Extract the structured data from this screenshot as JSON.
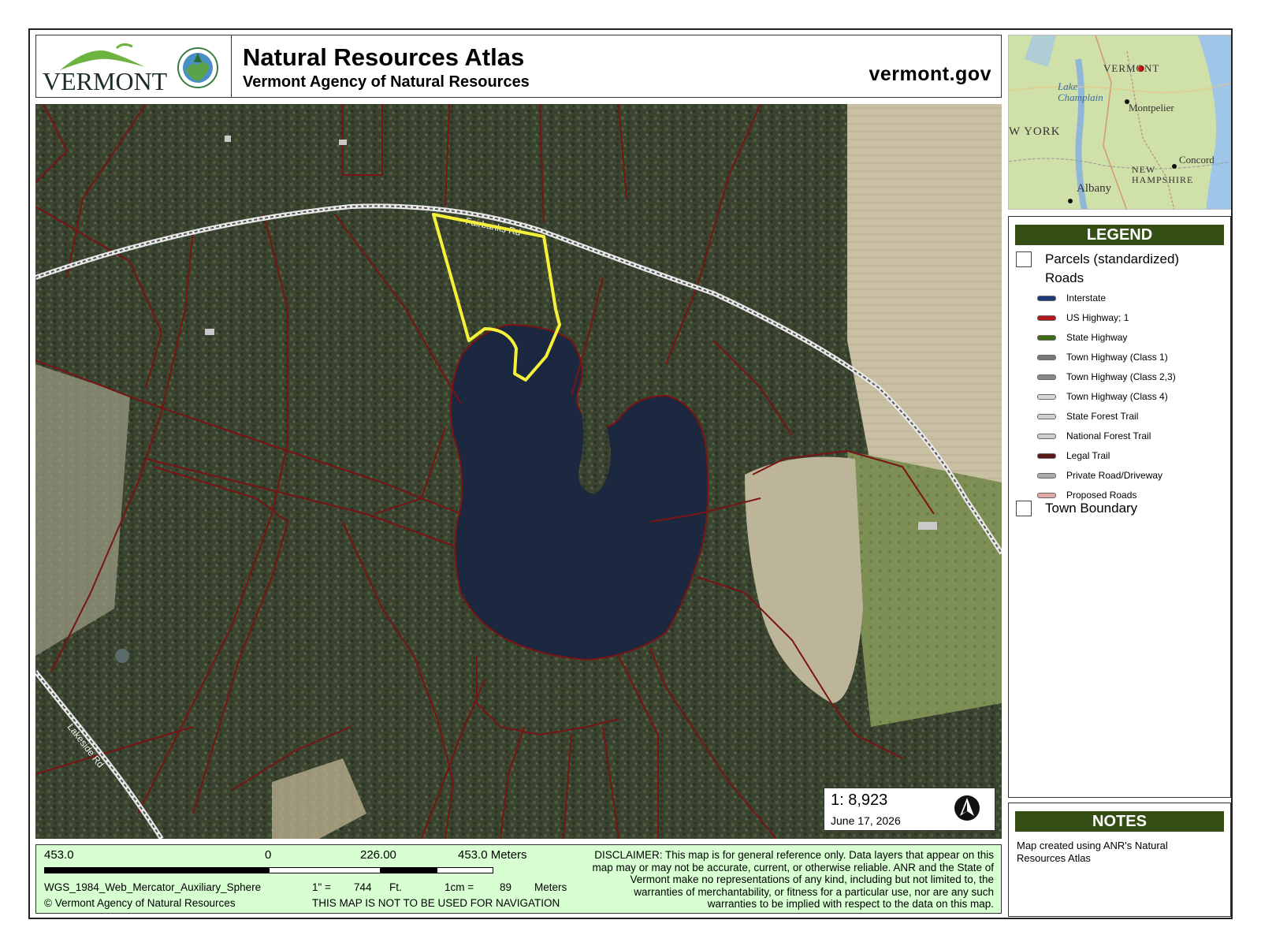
{
  "header": {
    "logo_text": "VERMONT",
    "title": "Natural Resources Atlas",
    "subtitle": "Vermont Agency of Natural Resources",
    "site": "vermont.gov"
  },
  "map": {
    "road_labels": [
      "Fairbanks Rd",
      "Lakeside Rd"
    ],
    "selected_parcel_color": "#f5f03a",
    "parcel_line_color": "#7a1414"
  },
  "scale_box": {
    "ratio": "1:  8,923",
    "date": "June 17, 2026",
    "north_arrow_icon": "north-arrow-icon"
  },
  "inset": {
    "labels": [
      "VERMONT",
      "Lake Champlain",
      "Montpelier",
      "W YORK",
      "Concord",
      "NEW HAMPSHIRE",
      "Albany"
    ]
  },
  "legend": {
    "heading": "LEGEND",
    "parcels_label": "Parcels (standardized)",
    "roads_label": "Roads",
    "road_items": [
      {
        "label": "Interstate",
        "color": "#1f3a78"
      },
      {
        "label": "US Highway; 1",
        "color": "#b3161b"
      },
      {
        "label": "State Highway",
        "color": "#3f6b14"
      },
      {
        "label": "Town Highway (Class 1)",
        "color": "#777777"
      },
      {
        "label": "Town Highway (Class 2,3)",
        "color": "#888888"
      },
      {
        "label": "Town Highway (Class 4)",
        "color": "#d7d7d7"
      },
      {
        "label": "State Forest Trail",
        "color": "#cfcfcf"
      },
      {
        "label": "National Forest Trail",
        "color": "#cfcfcf"
      },
      {
        "label": "Legal Trail",
        "color": "#5a1a1a"
      },
      {
        "label": "Private Road/Driveway",
        "color": "#aaaaaa"
      },
      {
        "label": "Proposed Roads",
        "color": "#e3a7a7"
      }
    ],
    "town_boundary_label": "Town Boundary"
  },
  "notes": {
    "heading": "NOTES",
    "text": "Map created using ANR's Natural Resources Atlas"
  },
  "footer": {
    "scale_labels": [
      "453.0",
      "0",
      "226.00",
      "453.0 Meters"
    ],
    "projection": "WGS_1984_Web_Mercator_Auxiliary_Sphere",
    "copyright": "© Vermont Agency of Natural Resources",
    "inch_label": "1\" =",
    "inch_value": "744",
    "inch_unit": "Ft.",
    "cm_label": "1cm =",
    "cm_value": "89",
    "cm_unit": "Meters",
    "navigation_warning": "THIS MAP IS NOT TO BE USED FOR NAVIGATION",
    "disclaimer": "DISCLAIMER: This map is for general reference only. Data layers that appear on this map may or may not be accurate, current, or otherwise reliable. ANR and the State of Vermont make no representations of any kind, including but not limited to, the warranties of merchantability, or fitness for a particular use, nor are any such warranties to be implied with respect to the data on this map."
  }
}
